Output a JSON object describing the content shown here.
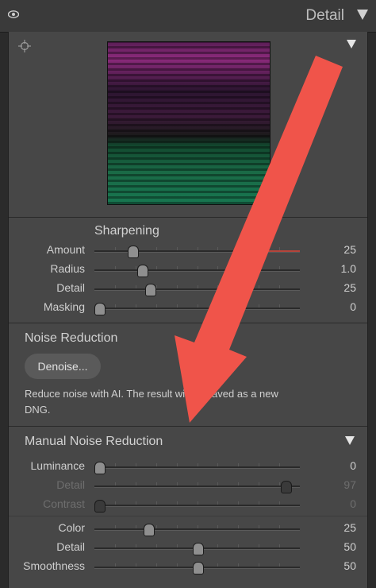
{
  "header": {
    "title": "Detail"
  },
  "sharpening": {
    "title": "Sharpening",
    "rows": [
      {
        "label": "Amount",
        "value": "25",
        "level": 0.17
      },
      {
        "label": "Radius",
        "value": "1.0",
        "level": 0.22
      },
      {
        "label": "Detail",
        "value": "25",
        "level": 0.26
      },
      {
        "label": "Masking",
        "value": "0",
        "level": 0.0
      }
    ]
  },
  "noise_reduction": {
    "title": "Noise Reduction",
    "denoise_label": "Denoise...",
    "description": "Reduce noise with AI. The result will be saved as a new DNG."
  },
  "manual_noise": {
    "title": "Manual Noise Reduction",
    "luminance_rows": [
      {
        "label": "Luminance",
        "value": "0",
        "level": 0.0,
        "dim": false
      },
      {
        "label": "Detail",
        "value": "97",
        "level": 0.95,
        "dim": true
      },
      {
        "label": "Contrast",
        "value": "0",
        "level": 0.0,
        "dim": true
      }
    ],
    "color_rows": [
      {
        "label": "Color",
        "value": "25",
        "level": 0.25,
        "dim": false
      },
      {
        "label": "Detail",
        "value": "50",
        "level": 0.5,
        "dim": false
      },
      {
        "label": "Smoothness",
        "value": "50",
        "level": 0.5,
        "dim": false
      }
    ]
  },
  "colors": {
    "arrow": "#f0544a",
    "panel": "#474747",
    "accent_red": "#b6443b"
  }
}
